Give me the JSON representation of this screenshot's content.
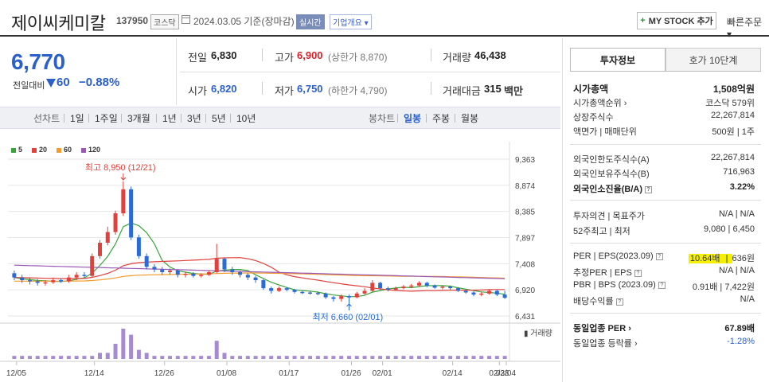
{
  "header": {
    "stock_name": "제이씨케미칼",
    "stock_code": "137950",
    "market_tag": "코스닥",
    "date_text": "2024.03.05  기준(장마감)",
    "realtime_tag": "실시간",
    "company_tag": "기업개요 ▾",
    "mystock_label": "MY STOCK 추가",
    "quick_order": "빠른주문 ▾"
  },
  "price": {
    "current": "6,770",
    "change_label": "전일대비",
    "change_value": "60",
    "change_rate": "−0.88%"
  },
  "quote": {
    "prev_close_label": "전일",
    "prev_close": "6,830",
    "high_label": "고가",
    "high": "6,900",
    "upper_limit": "(상한가 8,870)",
    "volume_label": "거래량",
    "volume": "46,438",
    "open_label": "시가",
    "open": "6,820",
    "low_label": "저가",
    "low": "6,750",
    "lower_limit": "(하한가 4,790)",
    "amount_label": "거래대금",
    "amount": "315",
    "amount_unit": "백만"
  },
  "period_bar": {
    "line_chart": "선차트",
    "periods": [
      "1일",
      "1주일",
      "3개월",
      "1년",
      "3년",
      "5년",
      "10년"
    ],
    "candle_chart": "봉차트",
    "candle_periods": [
      "일봉",
      "주봉",
      "월봉"
    ]
  },
  "chart_data": {
    "type": "candlestick",
    "legend": [
      "5",
      "20",
      "60",
      "120"
    ],
    "legend_colors": [
      "#3aa33a",
      "#e0413c",
      "#f39c2d",
      "#9b59b6"
    ],
    "y_ticks": [
      "9,363",
      "8,874",
      "8,385",
      "7,897",
      "7,408",
      "6,920",
      "6,431"
    ],
    "y_range": [
      6431,
      9363
    ],
    "x_labels": [
      "12/05",
      "12/14",
      "12/26",
      "01/08",
      "01/17",
      "01/26",
      "02/01",
      "02/14",
      "02/23",
      "03/04"
    ],
    "high_annotation": "최고 8,950 (12/21)",
    "low_annotation": "최저 6,660 (02/01)",
    "volume_label": "거래량",
    "candles": [
      [
        7230,
        7150,
        7280,
        7100
      ],
      [
        7150,
        7100,
        7200,
        7050
      ],
      [
        7100,
        7080,
        7150,
        7020
      ],
      [
        7080,
        7050,
        7120,
        7000
      ],
      [
        7050,
        7060,
        7100,
        7000
      ],
      [
        7060,
        7100,
        7150,
        7030
      ],
      [
        7100,
        7080,
        7130,
        7050
      ],
      [
        7080,
        7150,
        7200,
        7050
      ],
      [
        7150,
        7200,
        7250,
        7100
      ],
      [
        7200,
        7180,
        7250,
        7150
      ],
      [
        7180,
        7550,
        7600,
        7150
      ],
      [
        7550,
        7800,
        7850,
        7500
      ],
      [
        7800,
        8000,
        8100,
        7750
      ],
      [
        8000,
        8350,
        8400,
        7950
      ],
      [
        8350,
        8800,
        8950,
        8300
      ],
      [
        8800,
        7900,
        8850,
        7850
      ],
      [
        7900,
        7550,
        7950,
        7500
      ],
      [
        7550,
        7350,
        7600,
        7300
      ],
      [
        7350,
        7300,
        7400,
        7250
      ],
      [
        7300,
        7250,
        7350,
        7200
      ],
      [
        7250,
        7280,
        7320,
        7200
      ],
      [
        7280,
        7200,
        7300,
        7150
      ],
      [
        7200,
        7220,
        7260,
        7150
      ],
      [
        7220,
        7180,
        7250,
        7150
      ],
      [
        7180,
        7200,
        7230,
        7150
      ],
      [
        7200,
        7250,
        7280,
        7180
      ],
      [
        7250,
        7500,
        7780,
        7230
      ],
      [
        7500,
        7300,
        7520,
        7250
      ],
      [
        7300,
        7250,
        7350,
        7200
      ],
      [
        7250,
        7200,
        7280,
        7150
      ],
      [
        7200,
        7150,
        7230,
        7100
      ],
      [
        7150,
        7100,
        7180,
        7050
      ],
      [
        7100,
        6950,
        7120,
        6920
      ],
      [
        6950,
        6900,
        6980,
        6850
      ],
      [
        6900,
        6950,
        6980,
        6880
      ],
      [
        6950,
        6920,
        6970,
        6890
      ],
      [
        6920,
        6880,
        6940,
        6850
      ],
      [
        6880,
        6870,
        6910,
        6840
      ],
      [
        6870,
        6860,
        6900,
        6830
      ],
      [
        6860,
        6850,
        6890,
        6820
      ],
      [
        6850,
        6780,
        6870,
        6750
      ],
      [
        6780,
        6750,
        6800,
        6700
      ],
      [
        6750,
        6800,
        6830,
        6700
      ],
      [
        6800,
        6780,
        6830,
        6660
      ],
      [
        6780,
        6850,
        6880,
        6760
      ],
      [
        6850,
        6900,
        6950,
        6830
      ],
      [
        6900,
        7050,
        7100,
        6880
      ],
      [
        7050,
        6950,
        7070,
        6920
      ],
      [
        6950,
        6920,
        6980,
        6890
      ],
      [
        6920,
        6950,
        6980,
        6900
      ],
      [
        6950,
        6980,
        7010,
        6930
      ],
      [
        6980,
        7000,
        7030,
        6950
      ],
      [
        7000,
        7050,
        7080,
        6980
      ],
      [
        7050,
        7000,
        7070,
        6970
      ],
      [
        7000,
        6960,
        7020,
        6940
      ],
      [
        6960,
        6980,
        7000,
        6930
      ],
      [
        6980,
        6950,
        7000,
        6920
      ],
      [
        6950,
        6900,
        6970,
        6880
      ],
      [
        6900,
        6870,
        6920,
        6850
      ],
      [
        6870,
        6830,
        6890,
        6800
      ],
      [
        6830,
        6850,
        6880,
        6800
      ],
      [
        6850,
        6900,
        6930,
        6830
      ],
      [
        6900,
        6830,
        6920,
        6800
      ],
      [
        6830,
        6770,
        6900,
        6750
      ]
    ],
    "volumes": [
      1,
      1,
      1,
      1,
      1,
      1,
      1,
      1,
      1,
      1,
      1,
      2,
      2,
      5,
      10,
      8,
      3,
      2,
      1,
      1,
      1,
      1,
      1,
      1,
      1,
      1,
      6,
      2,
      1,
      1,
      1,
      1,
      1,
      1,
      1,
      1,
      1,
      1,
      1,
      1,
      1,
      1,
      1,
      1,
      1,
      1,
      1,
      1,
      1,
      1,
      1,
      1,
      1,
      1,
      1,
      1,
      1,
      1,
      1,
      1,
      1,
      1,
      1,
      1
    ]
  },
  "invest_panel": {
    "tab_invest": "투자정보",
    "tab_hoga": "호가 10단계",
    "market_cap_label": "시가총액",
    "market_cap": "1,508억원",
    "market_cap_rank_label": "시가총액순위 ›",
    "market_cap_rank": "코스닥 579위",
    "shares_label": "상장주식수",
    "shares": "22,267,814",
    "par_label": "액면가 | 매매단위",
    "par": "500원 | 1주",
    "foreign_limit_label": "외국인한도주식수(A)",
    "foreign_limit": "22,267,814",
    "foreign_hold_label": "외국인보유주식수(B)",
    "foreign_hold": "716,963",
    "foreign_ratio_label": "외국인소진율(B/A)",
    "foreign_ratio": "3.22%",
    "opinion_label": "투자의견 | 목표주가",
    "opinion": "N/A | N/A",
    "week52_label": "52주최고 | 최저",
    "week52": "9,080 | 6,450",
    "per_label": "PER | EPS(2023.09)",
    "per": "10.64배",
    "eps": "636원",
    "est_per_label": "추정PER | EPS",
    "est_per": "N/A | N/A",
    "pbr_label": "PBR | BPS (2023.09)",
    "pbr": "0.91배 | 7,422원",
    "dividend_label": "배당수익률",
    "dividend": "N/A",
    "industry_per_label": "동일업종 PER ›",
    "industry_per": "67.89배",
    "industry_rate_label": "동일업종 등락률 ›",
    "industry_rate": "-1.28%"
  }
}
